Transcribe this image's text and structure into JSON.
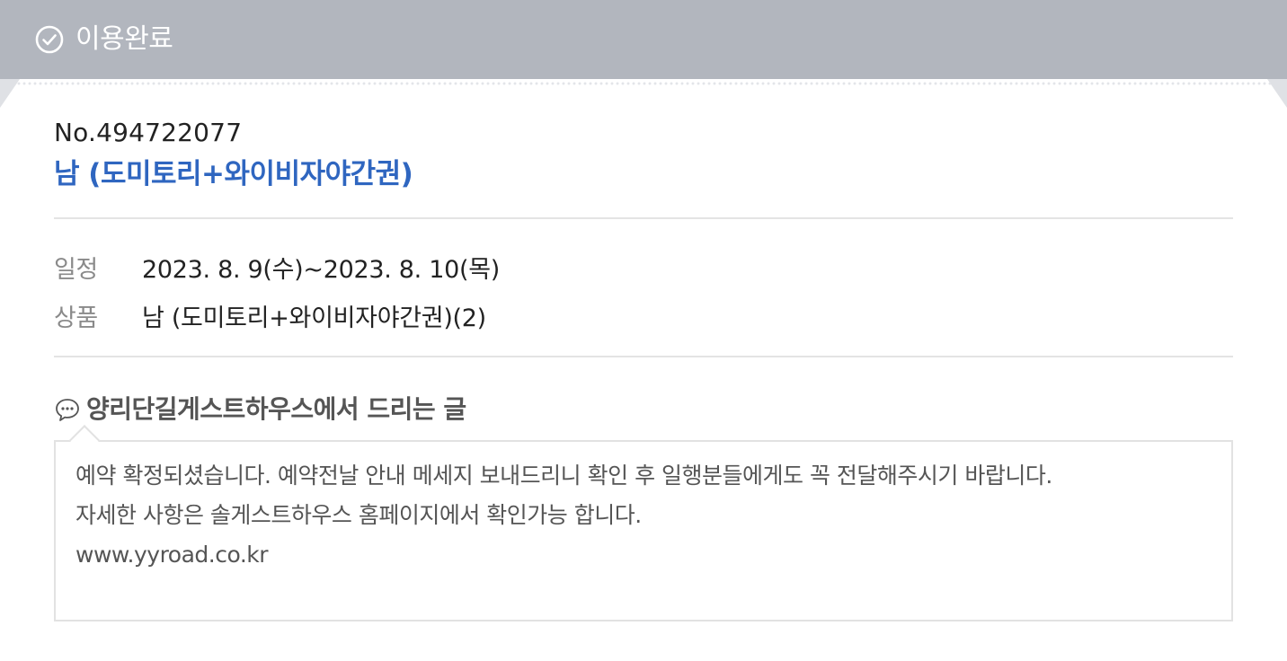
{
  "status": {
    "icon": "check-circle-icon",
    "label": "이용완료",
    "bg_color": "#b2b6be"
  },
  "reservation": {
    "number": "No.494722077",
    "title": "남 (도미토리+와이비자야간권)",
    "title_color": "#2f66c0"
  },
  "details": [
    {
      "key": "일정",
      "value": "2023. 8. 9(수)~2023. 8. 10(목)"
    },
    {
      "key": "상품",
      "value": "남 (도미토리+와이비자야간권)(2)"
    }
  ],
  "message": {
    "icon": "speech-bubble-icon",
    "header": "양리단길게스트하우스에서 드리는 글",
    "lines": [
      "예약 확정되셨습니다. 예약전날 안내 메세지 보내드리니 확인 후 일행분들에게도 꼭 전달해주시기 바랍니다.",
      "자세한 사항은 솔게스트하우스 홈페이지에서 확인가능 합니다.",
      "www.yyroad.co.kr"
    ]
  }
}
